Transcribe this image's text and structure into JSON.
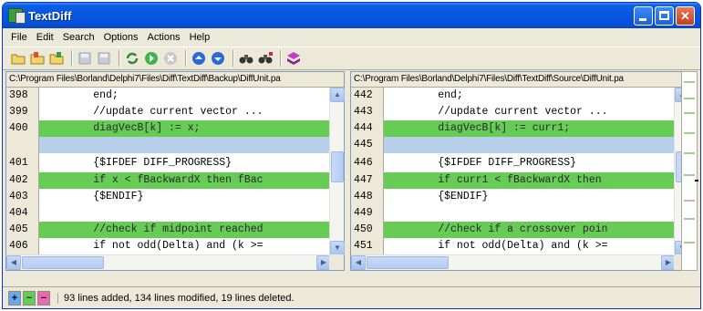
{
  "window": {
    "title": "TextDiff",
    "controls": {
      "minimize": "minimize",
      "maximize": "maximize",
      "close": "✕"
    }
  },
  "menu": [
    "File",
    "Edit",
    "Search",
    "Options",
    "Actions",
    "Help"
  ],
  "toolbar": {
    "icons": [
      "open-folder-icon",
      "open-left-icon",
      "open-right-icon",
      "save-left-icon",
      "save-right-icon",
      "refresh-icon",
      "go-green-icon",
      "cancel-icon",
      "prev-diff-icon",
      "next-diff-icon",
      "find-icon",
      "find-next-icon",
      "diff-options-icon"
    ]
  },
  "left_pane": {
    "path": "C:\\Program Files\\Borland\\Delphi7\\Files\\Diff\\TextDiff\\Backup\\DiffUnit.pa",
    "lines": [
      {
        "num": "398",
        "code": "        end;",
        "state": "normal"
      },
      {
        "num": "399",
        "code": "        //update current vector ...",
        "state": "normal"
      },
      {
        "num": "400",
        "code": "        diagVecB[k] := x;",
        "state": "mod"
      },
      {
        "num": "",
        "code": "",
        "state": "blank"
      },
      {
        "num": "401",
        "code": "        {$IFDEF DIFF_PROGRESS}",
        "state": "normal"
      },
      {
        "num": "402",
        "code": "        if x < fBackwardX then fBac",
        "state": "mod"
      },
      {
        "num": "403",
        "code": "        {$ENDIF}",
        "state": "normal"
      },
      {
        "num": "404",
        "code": "",
        "state": "normal"
      },
      {
        "num": "405",
        "code": "        //check if midpoint reached",
        "state": "mod"
      },
      {
        "num": "406",
        "code": "        if not odd(Delta) and (k >=",
        "state": "normal"
      }
    ]
  },
  "right_pane": {
    "path": "C:\\Program Files\\Borland\\Delphi7\\Files\\Diff\\TextDiff\\Source\\DiffUnit.pa",
    "lines": [
      {
        "num": "442",
        "code": "        end;",
        "state": "normal"
      },
      {
        "num": "443",
        "code": "        //update current vector ...",
        "state": "normal"
      },
      {
        "num": "444",
        "code": "        diagVecB[k] := curr1;",
        "state": "mod"
      },
      {
        "num": "445",
        "code": "",
        "state": "blank"
      },
      {
        "num": "446",
        "code": "        {$IFDEF DIFF_PROGRESS}",
        "state": "normal"
      },
      {
        "num": "447",
        "code": "        if curr1 < fBackwardX then",
        "state": "mod"
      },
      {
        "num": "448",
        "code": "        {$ENDIF}",
        "state": "normal"
      },
      {
        "num": "449",
        "code": "",
        "state": "normal"
      },
      {
        "num": "450",
        "code": "        //check if a crossover poin",
        "state": "mod"
      },
      {
        "num": "451",
        "code": "        if not odd(Delta) and (k >=",
        "state": "normal"
      }
    ]
  },
  "status": {
    "legend": {
      "added": "+",
      "modified": "~",
      "deleted": "−"
    },
    "colors": {
      "added": "#6aa8e8",
      "modified": "#66cc55",
      "deleted": "#e86ab0"
    },
    "text": "93 lines added, 134 lines modified, 19 lines deleted."
  }
}
